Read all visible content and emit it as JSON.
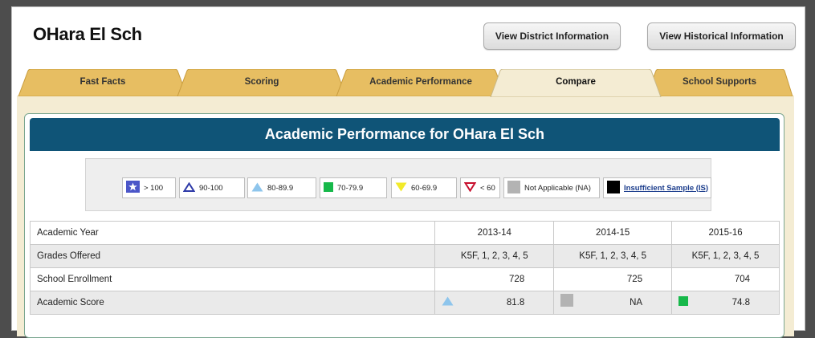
{
  "school": {
    "name": "OHara El Sch"
  },
  "header": {
    "district_button": "View District Information",
    "historical_button": "View Historical Information"
  },
  "tabs": [
    {
      "label": "Fast Facts",
      "active": false
    },
    {
      "label": "Scoring",
      "active": false
    },
    {
      "label": "Academic Performance",
      "active": false
    },
    {
      "label": "Compare",
      "active": true
    },
    {
      "label": "School Supports",
      "active": false
    }
  ],
  "banner": {
    "title": "Academic Performance for OHara El Sch"
  },
  "legend": [
    {
      "icon": "star-icon",
      "label": "> 100",
      "color": "#4b56c8"
    },
    {
      "icon": "triangle-up-outline-icon",
      "label": "90-100",
      "color": "#2e3aa8"
    },
    {
      "icon": "triangle-up-icon",
      "label": "80-89.9",
      "color": "#8ec5ec"
    },
    {
      "icon": "square-icon",
      "label": "70-79.9",
      "color": "#17b84a"
    },
    {
      "icon": "triangle-down-icon",
      "label": "60-69.9",
      "color": "#f2ea2a"
    },
    {
      "icon": "triangle-down-outline-icon",
      "label": "< 60",
      "color": "#c8102e"
    },
    {
      "icon": "gray-square-icon",
      "label": "Not Applicable (NA)",
      "color": "#b3b3b3"
    },
    {
      "icon": "black-square-icon",
      "label": "Insufficient Sample (IS)",
      "color": "#000000"
    }
  ],
  "table": {
    "years": [
      "2013-14",
      "2014-15",
      "2015-16"
    ],
    "rows": {
      "year_label": "Academic Year",
      "grades_label": "Grades Offered",
      "grades": [
        "K5F, 1, 2, 3, 4, 5",
        "K5F, 1, 2, 3, 4, 5",
        "K5F, 1, 2, 3, 4, 5"
      ],
      "enrollment_label": "School Enrollment",
      "enrollment": [
        "728",
        "725",
        "704"
      ],
      "score_label": "Academic Score",
      "scores": [
        {
          "value": "81.8",
          "icon": "triangle-up-icon"
        },
        {
          "value": "NA",
          "icon": "gray-square-icon"
        },
        {
          "value": "74.8",
          "icon": "square-icon"
        }
      ]
    }
  }
}
